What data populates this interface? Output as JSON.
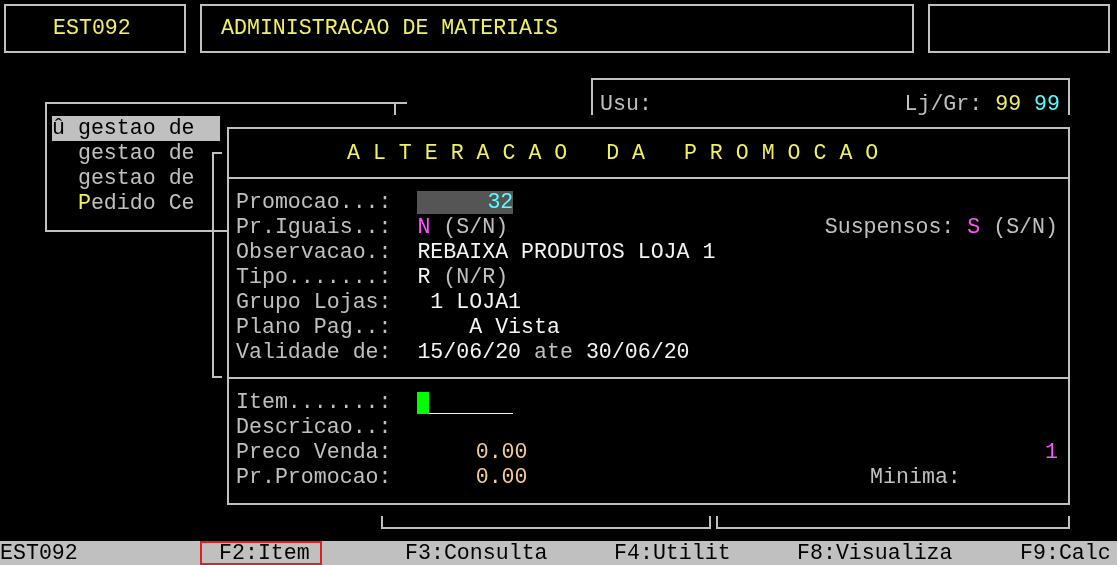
{
  "header": {
    "program_code": "EST092",
    "system_title": "ADMINISTRACAO DE MATERIAIS"
  },
  "user_panel": {
    "user_label": "Usu:",
    "store_group_label": "Lj/Gr:",
    "store": "99",
    "group": "99"
  },
  "menu": {
    "items": [
      {
        "marker": "û",
        "label": "gestao de",
        "selected": true,
        "hotkey_lit": false
      },
      {
        "label": "gestao de",
        "selected": false,
        "hotkey_lit": false
      },
      {
        "label": "gestao de",
        "selected": false,
        "hotkey_lit": false
      },
      {
        "label": "Pedido Ce",
        "selected": false,
        "hotkey_lit": true
      }
    ]
  },
  "dialog": {
    "title": "A L T E R A C A O   D A   P R O M O C A O",
    "promocao": {
      "label": "Promocao...:",
      "value": "32"
    },
    "precos_iguais": {
      "label": "Pr.Iguais..:",
      "value": "N",
      "options": "(S/N)"
    },
    "suspensos": {
      "label": "Suspensos:",
      "value": "S",
      "options": "(S/N)"
    },
    "observacao": {
      "label": "Observacao.:",
      "value": "REBAIXA PRODUTOS LOJA 1"
    },
    "tipo": {
      "label": "Tipo.......:",
      "value": "R",
      "options": "(N/R)"
    },
    "grupo_lojas": {
      "label": "Grupo Lojas:",
      "code": "1",
      "name": "LOJA1"
    },
    "plano_pag": {
      "label": "Plano Pag..:",
      "value": "A Vista"
    },
    "validade": {
      "label": "Validade de:",
      "from": "15/06/20",
      "to_label": "ate",
      "to": "30/06/20"
    },
    "item": {
      "label": "Item.......:"
    },
    "descricao": {
      "label": "Descricao..:"
    },
    "preco_venda": {
      "label": "Preco Venda:",
      "value": "0.00",
      "quantity": "1"
    },
    "preco_promocao": {
      "label": "Pr.Promocao:",
      "value": "0.00"
    },
    "minima": {
      "label": "Minima:"
    }
  },
  "function_bar": [
    {
      "label": "EST092",
      "selected": false
    },
    {
      "label": "F2:Item",
      "selected": true
    },
    {
      "label": "F3:Consulta",
      "selected": false
    },
    {
      "label": "F4:Utilit",
      "selected": false
    },
    {
      "label": "F8:Visualiza",
      "selected": false
    },
    {
      "label": "F9:Calc",
      "selected": false
    }
  ]
}
